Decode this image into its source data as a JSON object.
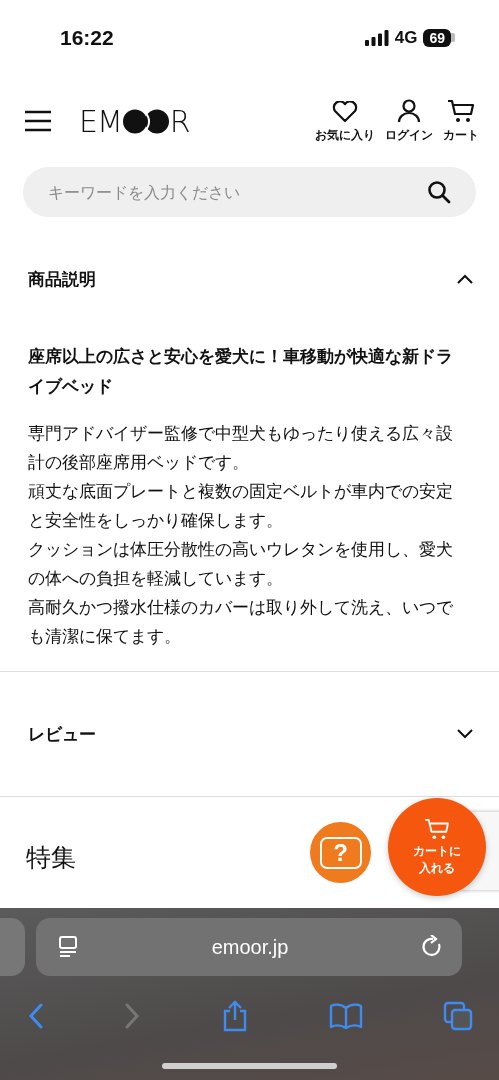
{
  "status_bar": {
    "time": "16:22",
    "network": "4G",
    "battery": "69"
  },
  "header": {
    "logo_start": "EM",
    "logo_end": "R",
    "actions": [
      {
        "kind": "heart",
        "label": "お気に入り"
      },
      {
        "kind": "user",
        "label": "ログイン"
      },
      {
        "kind": "cart",
        "label": "カート"
      }
    ]
  },
  "search": {
    "placeholder": "キーワードを入力ください"
  },
  "sections": [
    {
      "title": "商品説明",
      "expanded": true,
      "heading": "座席以上の広さと安心を愛犬に！車移動が快適な新ドライブベッド",
      "paragraphs": [
        "専門アドバイザー監修で中型犬もゆったり使える広々設計の後部座席用ベッドです。",
        "頑丈な底面プレートと複数の固定ベルトが車内での安定と安全性をしっかり確保します。",
        "クッションは体圧分散性の高いウレタンを使用し、愛犬の体への負担を軽減しています。",
        "高耐久かつ撥水仕様のカバーは取り外して洗え、いつでも清潔に保てます。"
      ]
    },
    {
      "title": "レビュー",
      "expanded": false
    }
  ],
  "feature_title": "特集",
  "floating": {
    "help_label": "?",
    "cart_label": "カートに入れる"
  },
  "browser": {
    "url": "emoor.jp"
  }
}
